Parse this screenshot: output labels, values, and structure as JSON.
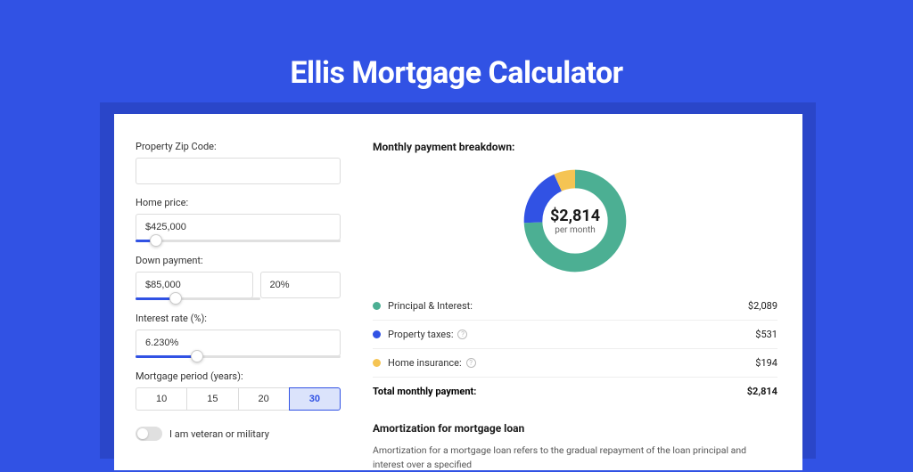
{
  "title": "Ellis Mortgage Calculator",
  "form": {
    "zip_label": "Property Zip Code:",
    "zip_value": "",
    "home_price_label": "Home price:",
    "home_price_value": "$425,000",
    "home_price_slider_pct": 10,
    "down_label": "Down payment:",
    "down_value": "$85,000",
    "down_pct": "20%",
    "down_slider_pct": 20,
    "rate_label": "Interest rate (%):",
    "rate_value": "6.230%",
    "rate_slider_pct": 30,
    "period_label": "Mortgage period (years):",
    "periods": [
      "10",
      "15",
      "20",
      "30"
    ],
    "period_selected": "30",
    "veteran_label": "I am veteran or military",
    "veteran_on": false
  },
  "breakdown": {
    "title": "Monthly payment breakdown:",
    "total_value": "$2,814",
    "total_sub": "per month",
    "items": [
      {
        "name": "Principal & Interest:",
        "value": "$2,089",
        "color": "#4caf93",
        "info": false
      },
      {
        "name": "Property taxes:",
        "value": "$531",
        "color": "#3152e4",
        "info": true
      },
      {
        "name": "Home insurance:",
        "value": "$194",
        "color": "#f5c453",
        "info": true
      }
    ],
    "total_label": "Total monthly payment:"
  },
  "chart_data": {
    "type": "pie",
    "title": "Monthly payment breakdown",
    "series": [
      {
        "name": "Principal & Interest",
        "value": 2089,
        "color": "#4caf93"
      },
      {
        "name": "Property taxes",
        "value": 531,
        "color": "#3152e4"
      },
      {
        "name": "Home insurance",
        "value": 194,
        "color": "#f5c453"
      }
    ],
    "total": 2814,
    "center_label": "$2,814",
    "center_sub": "per month"
  },
  "amortization": {
    "title": "Amortization for mortgage loan",
    "text": "Amortization for a mortgage loan refers to the gradual repayment of the loan principal and interest over a specified"
  }
}
